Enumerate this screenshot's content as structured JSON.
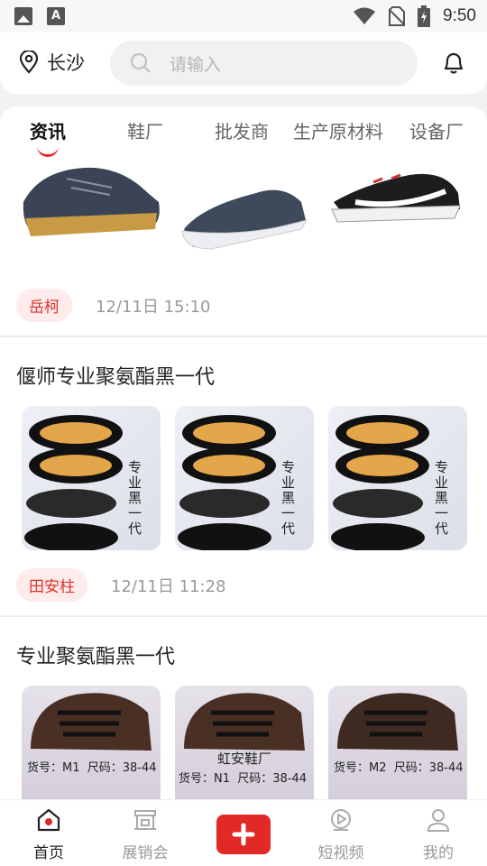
{
  "status_bar": {
    "time": "9:50",
    "icons": [
      "image-icon",
      "a-badge-icon",
      "wifi-icon",
      "no-sim-icon",
      "battery-charging-icon"
    ],
    "a_badge": "A"
  },
  "header": {
    "location": "长沙",
    "search_placeholder": "请输入",
    "icons": [
      "location-pin-icon",
      "search-icon",
      "bell-icon"
    ]
  },
  "tabs": [
    {
      "label": "资讯",
      "active": true
    },
    {
      "label": "鞋厂",
      "active": false
    },
    {
      "label": "批发商",
      "active": false
    },
    {
      "label": "生产原材料",
      "active": false
    },
    {
      "label": "设备厂",
      "active": false
    }
  ],
  "posts": [
    {
      "title": "",
      "author": "岳柯",
      "time": "12/11日 15:10",
      "photos": [
        "navy-hiking-shoe",
        "navy-slip-on",
        "black-running-shoe"
      ]
    },
    {
      "title": "偃师专业聚氨酯黑一代",
      "author": "田安柱",
      "time": "12/11日 11:28",
      "photos": [
        "black-cloth-shoes-1",
        "black-cloth-shoes-2",
        "black-cloth-shoes-3"
      ],
      "photo_caption": "专业黑一代"
    },
    {
      "title": "专业聚氨酯黑一代",
      "photos": [
        "brown-lace-shoe-m1",
        "brown-lace-shoe-n1",
        "brown-lace-shoe-m2"
      ],
      "photo_labels": [
        {
          "code": "货号：M1",
          "size": "尺码：38-44"
        },
        {
          "brand": "虹安鞋厂",
          "code": "货号：N1",
          "size": "尺码：38-44"
        },
        {
          "code": "货号：M2",
          "size": "尺码：38-44"
        }
      ]
    }
  ],
  "bottom_nav": [
    {
      "label": "首页",
      "icon": "home-icon",
      "active": true
    },
    {
      "label": "展销会",
      "icon": "exhibition-icon",
      "active": false
    },
    {
      "label": "",
      "icon": "plus-icon",
      "active": false
    },
    {
      "label": "短视频",
      "icon": "video-play-icon",
      "active": false
    },
    {
      "label": "我的",
      "icon": "user-icon",
      "active": false
    }
  ],
  "colors": {
    "accent": "#e12a26",
    "author_bg": "#fdeceb",
    "muted": "#999999"
  }
}
